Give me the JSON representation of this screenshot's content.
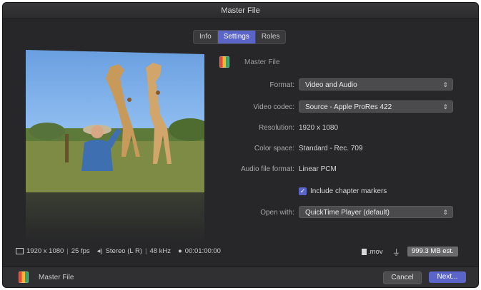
{
  "window": {
    "title": "Master File"
  },
  "tabs": [
    {
      "label": "Info",
      "active": false
    },
    {
      "label": "Settings",
      "active": true
    },
    {
      "label": "Roles",
      "active": false
    }
  ],
  "header": {
    "name": "Master File"
  },
  "settings": {
    "format": {
      "label": "Format:",
      "value": "Video and Audio"
    },
    "video_codec": {
      "label": "Video codec:",
      "value": "Source - Apple ProRes 422"
    },
    "resolution": {
      "label": "Resolution:",
      "value": "1920 x 1080"
    },
    "color_space": {
      "label": "Color space:",
      "value": "Standard - Rec. 709"
    },
    "audio_format": {
      "label": "Audio file format:",
      "value": "Linear PCM"
    },
    "chapter_markers": {
      "label": "Include chapter markers",
      "checked": true
    },
    "open_with": {
      "label": "Open with:",
      "value": "QuickTime Player (default)"
    }
  },
  "info_bar": {
    "video": "1920 x 1080",
    "fps": "25 fps",
    "audio": "Stereo (L R)",
    "sample_rate": "48 kHz",
    "duration": "00:01:00:00",
    "extension": ".mov",
    "size": "999.3 MB est."
  },
  "footer": {
    "name": "Master File",
    "cancel_label": "Cancel",
    "next_label": "Next..."
  },
  "colors": {
    "accent": "#5a64c9",
    "background": "#272729"
  }
}
